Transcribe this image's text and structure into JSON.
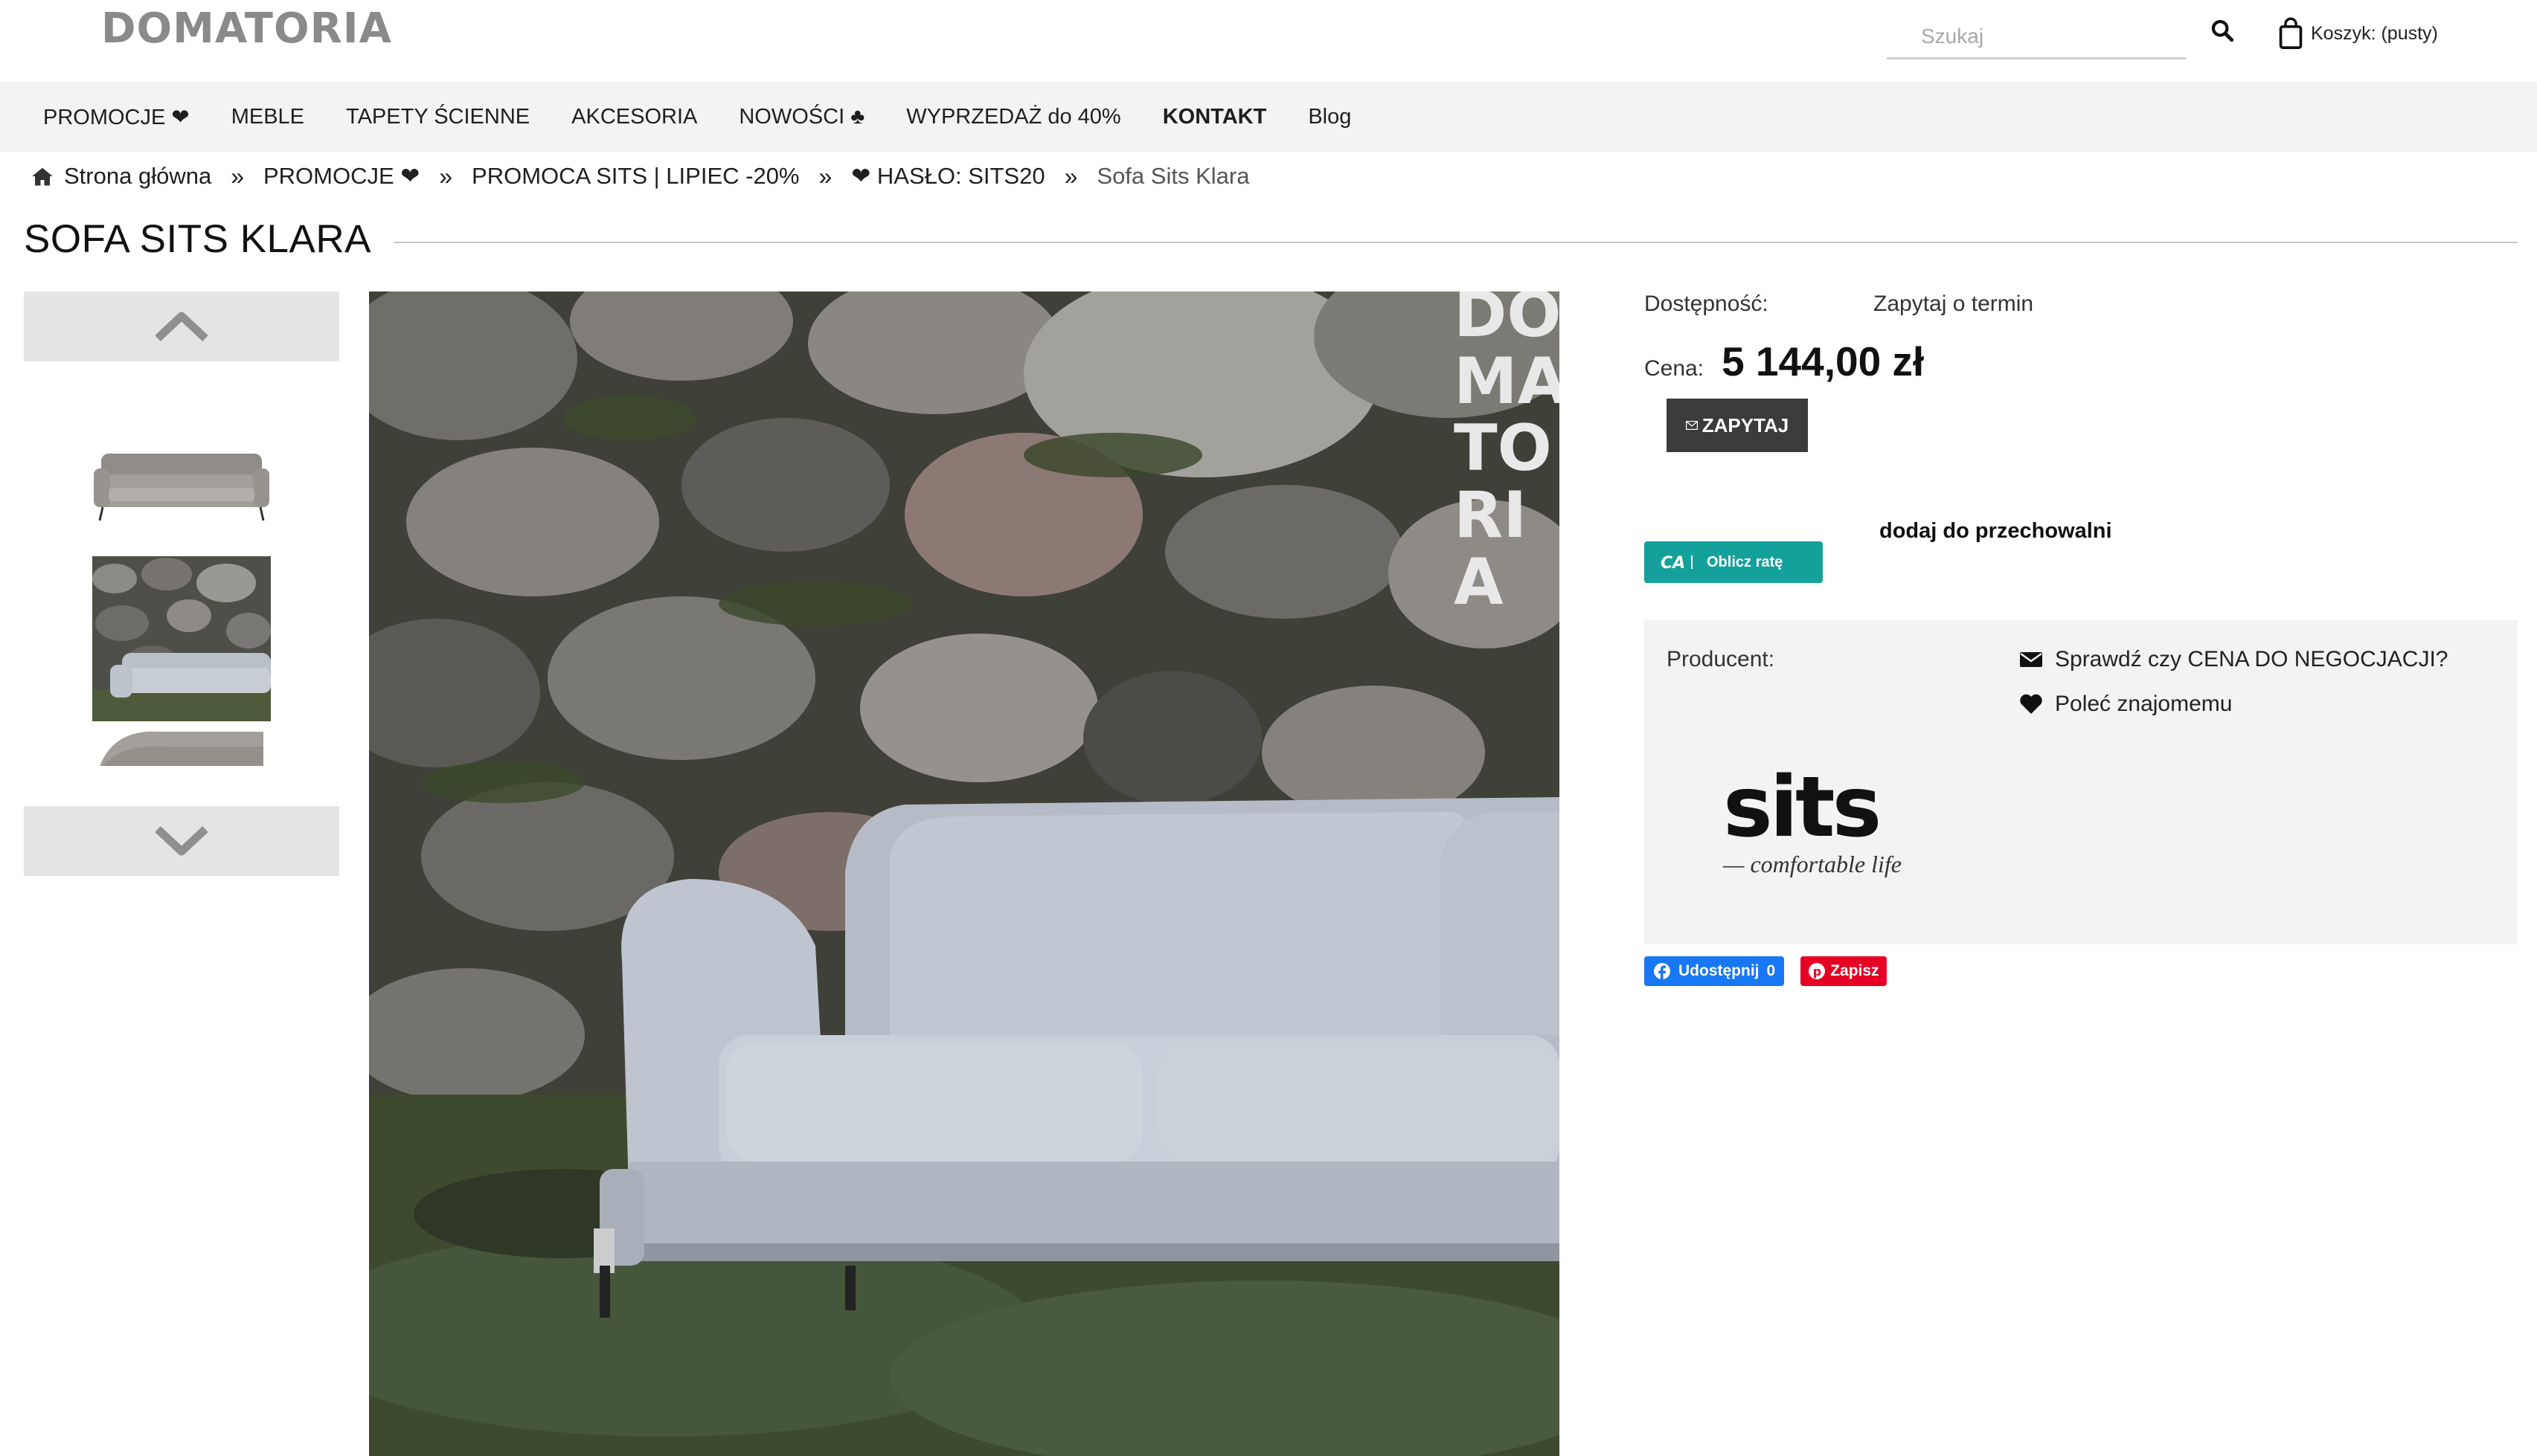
{
  "header": {
    "logo": "DOMATORIA",
    "search_placeholder": "Szukaj",
    "cart_label": "Koszyk: (pusty)"
  },
  "nav": {
    "items": [
      {
        "label": "PROMOCJE ❤"
      },
      {
        "label": "MEBLE"
      },
      {
        "label": "TAPETY ŚCIENNE"
      },
      {
        "label": "AKCESORIA"
      },
      {
        "label": "NOWOŚCI ♣"
      },
      {
        "label": "WYPRZEDAŻ do 40%"
      },
      {
        "label": "KONTAKT"
      },
      {
        "label": "Blog"
      }
    ]
  },
  "breadcrumb": {
    "items": [
      {
        "label": "Strona główna"
      },
      {
        "label": "PROMOCJE ❤"
      },
      {
        "label": "PROMOCA SITS | LIPIEC -20%"
      },
      {
        "label": "❤ HASŁO: SITS20"
      }
    ],
    "separator": "»",
    "current": "Sofa Sits Klara"
  },
  "product": {
    "title": "SOFA SITS KLARA",
    "availability_label": "Dostępność:",
    "availability_value": "Zapytaj o termin",
    "price_label": "Cena:",
    "price": "5 144,00 zł",
    "ask_button": "ZAPYTAJ",
    "calc_button": "Oblicz ratę",
    "wishlist_label": "dodaj do przechowalni",
    "producer_label": "Producent:",
    "negotiate_link": "Sprawdź czy CENA DO NEGOCJACJI?",
    "recommend_link": "Poleć znajomemu",
    "brand_word": "sits",
    "brand_tagline": "— comfortable life",
    "watermark": [
      "DO",
      "MA",
      "TO",
      "RI",
      "A"
    ]
  },
  "share": {
    "facebook_label": "Udostępnij",
    "facebook_count": "0",
    "pinterest_label": "Zapisz"
  },
  "colors": {
    "nav_bg": "#f3f3f3",
    "button_dark": "#3b3b3b",
    "calc_teal": "#14a19b",
    "facebook_blue": "#1877f2",
    "pinterest_red": "#e60023"
  }
}
